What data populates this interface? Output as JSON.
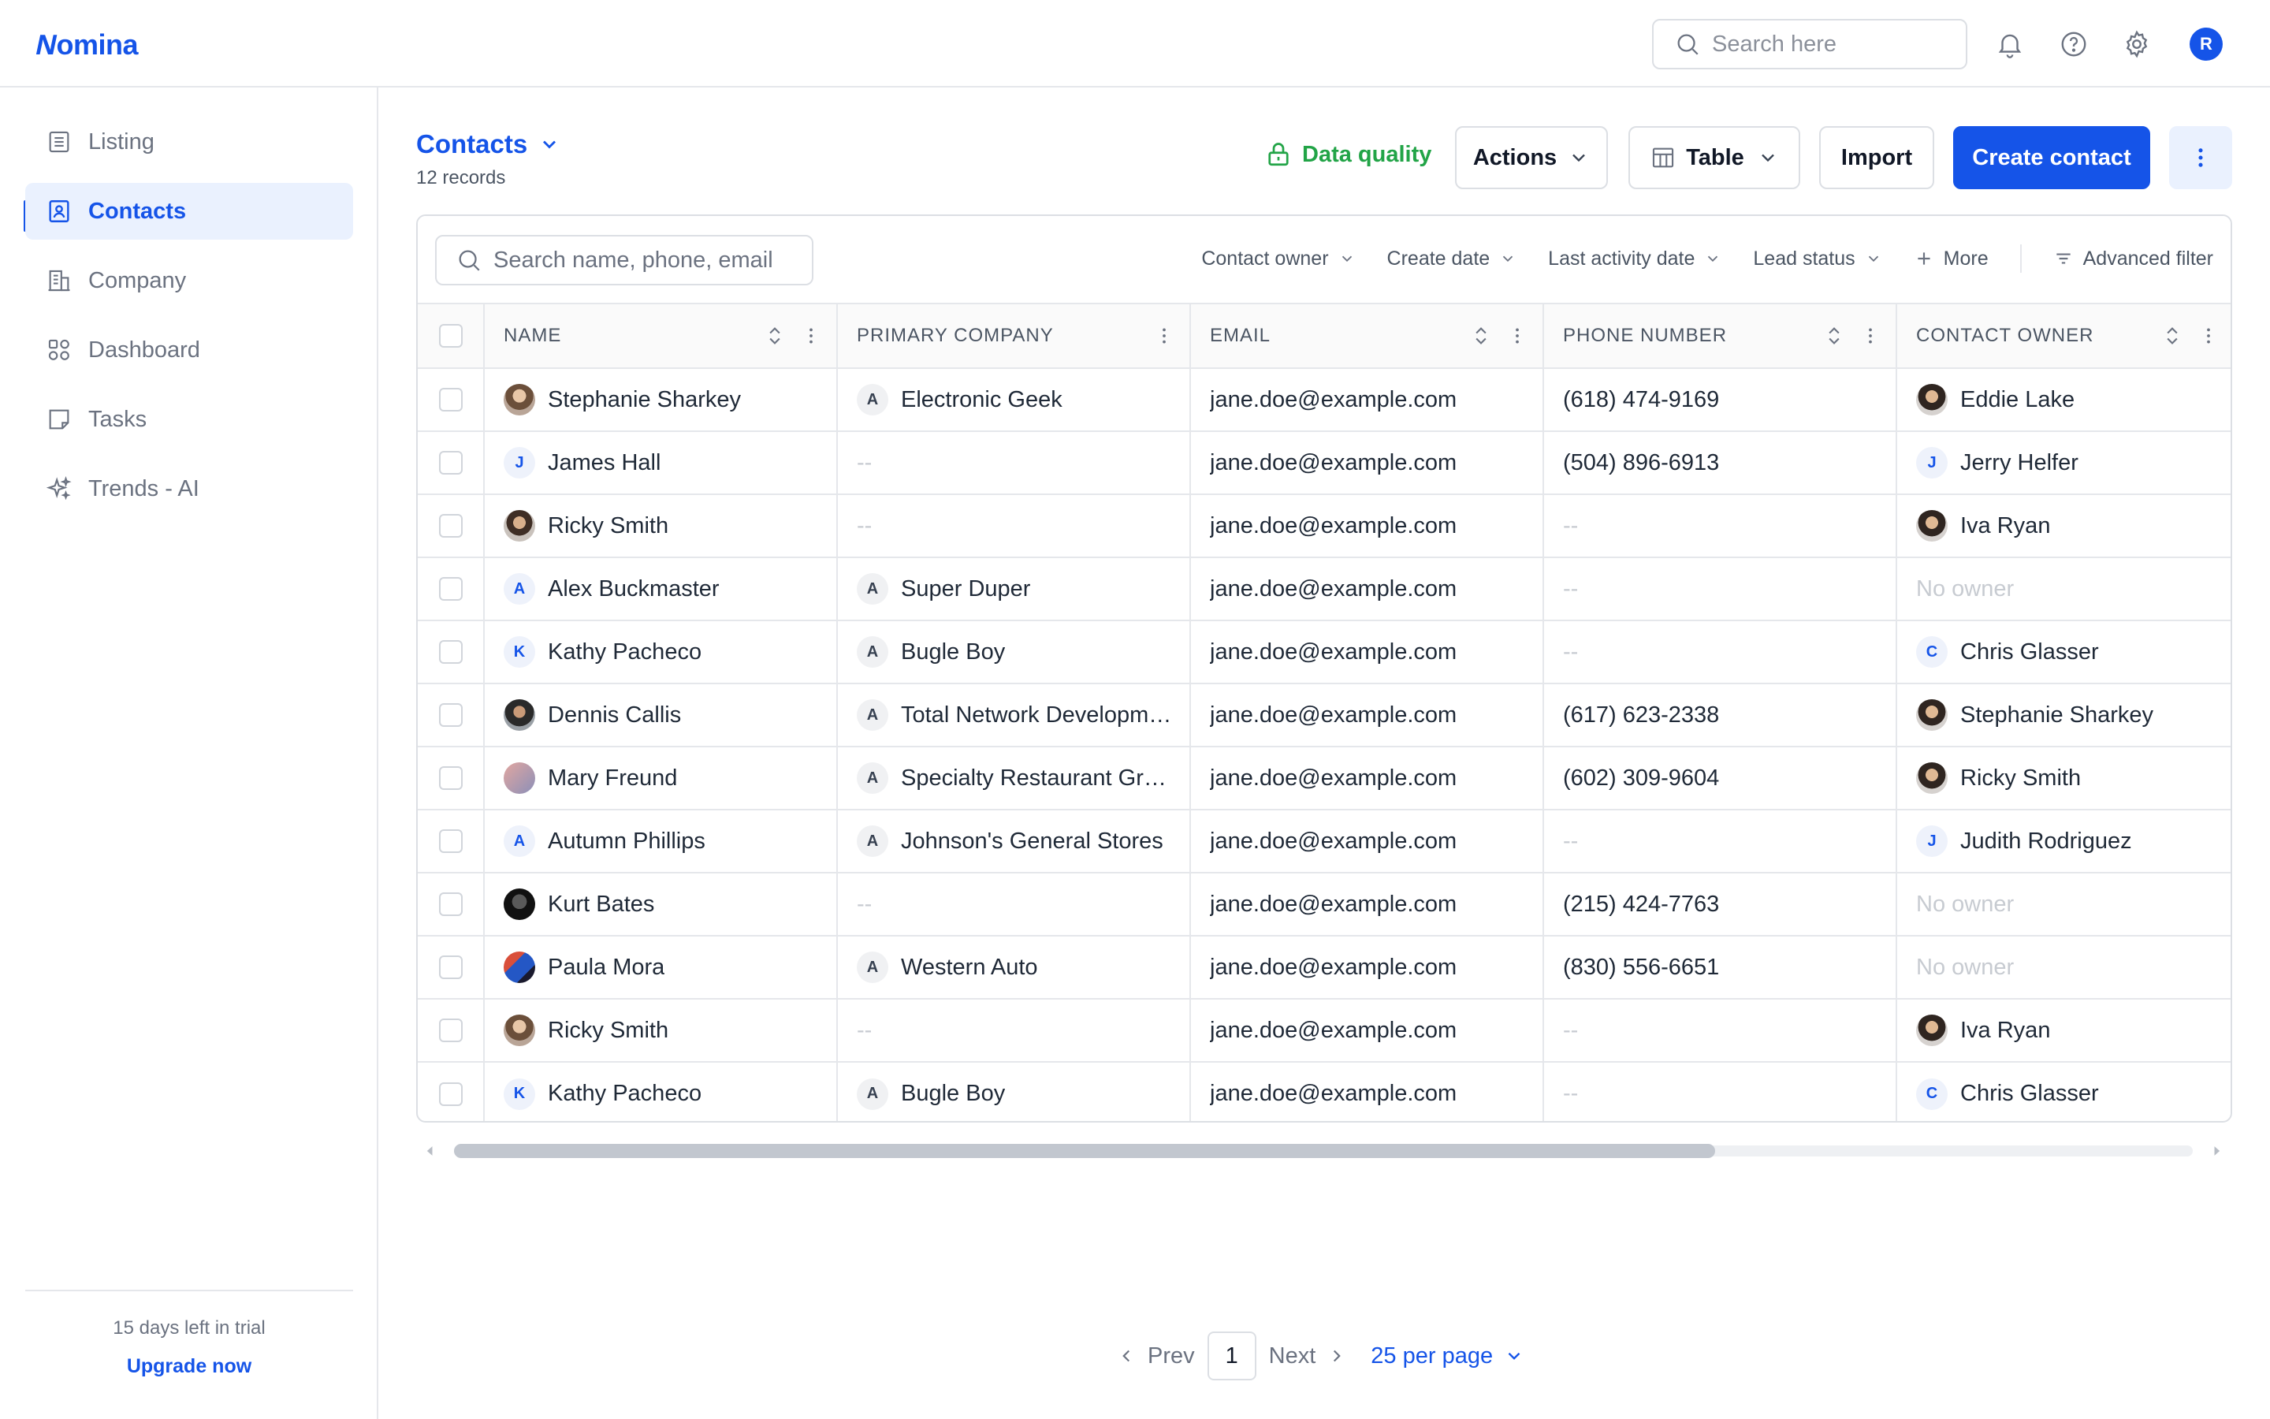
{
  "app": {
    "logo_first": "N",
    "logo_rest": "omina"
  },
  "topbar": {
    "search_placeholder": "Search here",
    "avatar_initial": "R"
  },
  "sidebar": {
    "items": [
      {
        "label": "Listing",
        "icon": "listing-icon"
      },
      {
        "label": "Contacts",
        "icon": "contacts-icon",
        "active": true
      },
      {
        "label": "Company",
        "icon": "building-icon"
      },
      {
        "label": "Dashboard",
        "icon": "dashboard-icon"
      },
      {
        "label": "Tasks",
        "icon": "tasks-icon"
      },
      {
        "label": "Trends - AI",
        "icon": "sparkle-icon"
      }
    ],
    "trial_text": "15 days left in trial",
    "upgrade_label": "Upgrade now"
  },
  "header": {
    "title": "Contacts",
    "records": "12 records",
    "data_quality": "Data quality",
    "actions": "Actions",
    "view": "Table",
    "import": "Import",
    "create": "Create contact"
  },
  "table_toolbar": {
    "search_placeholder": "Search name, phone, email",
    "filters": [
      "Contact owner",
      "Create date",
      "Last activity date",
      "Lead status"
    ],
    "more": "More",
    "advanced": "Advanced filter"
  },
  "columns": [
    "NAME",
    "PRIMARY COMPANY",
    "EMAIL",
    "PHONE NUMBER",
    "CONTACT OWNER"
  ],
  "rows": [
    {
      "name": "Stephanie Sharkey",
      "avatar": "photo",
      "company": "Electronic Geek",
      "email": "jane.doe@example.com",
      "phone": "(618) 474-9169",
      "owner": "Eddie Lake",
      "owner_avatar": "photo"
    },
    {
      "name": "James Hall",
      "avatar": "J",
      "company": "--",
      "email": "jane.doe@example.com",
      "phone": "(504) 896-6913",
      "owner": "Jerry Helfer",
      "owner_avatar": "J"
    },
    {
      "name": "Ricky Smith",
      "avatar": "photo",
      "company": "--",
      "email": "jane.doe@example.com",
      "phone": "--",
      "owner": "Iva Ryan",
      "owner_avatar": "photo"
    },
    {
      "name": "Alex Buckmaster",
      "avatar": "A",
      "company": "Super Duper",
      "email": "jane.doe@example.com",
      "phone": "--",
      "owner": "No owner",
      "owner_avatar": ""
    },
    {
      "name": "Kathy Pacheco",
      "avatar": "K",
      "company": "Bugle Boy",
      "email": "jane.doe@example.com",
      "phone": "--",
      "owner": "Chris Glasser",
      "owner_avatar": "C"
    },
    {
      "name": "Dennis Callis",
      "avatar": "photo",
      "company": "Total Network Development",
      "email": "jane.doe@example.com",
      "phone": "(617) 623-2338",
      "owner": "Stephanie Sharkey",
      "owner_avatar": "photo"
    },
    {
      "name": "Mary Freund",
      "avatar": "photo",
      "company": "Specialty Restaurant Group",
      "email": "jane.doe@example.com",
      "phone": "(602) 309-9604",
      "owner": "Ricky Smith",
      "owner_avatar": "photo"
    },
    {
      "name": "Autumn Phillips",
      "avatar": "A",
      "company": "Johnson's General Stores",
      "email": "jane.doe@example.com",
      "phone": "--",
      "owner": "Judith Rodriguez",
      "owner_avatar": "J"
    },
    {
      "name": "Kurt Bates",
      "avatar": "photo",
      "company": "--",
      "email": "jane.doe@example.com",
      "phone": "(215) 424-7763",
      "owner": "No owner",
      "owner_avatar": ""
    },
    {
      "name": "Paula Mora",
      "avatar": "photo",
      "company": "Western Auto",
      "email": "jane.doe@example.com",
      "phone": "(830) 556-6651",
      "owner": "No owner",
      "owner_avatar": ""
    },
    {
      "name": "Ricky Smith",
      "avatar": "photo",
      "company": "--",
      "email": "jane.doe@example.com",
      "phone": "--",
      "owner": "Iva Ryan",
      "owner_avatar": "photo"
    },
    {
      "name": "Kathy Pacheco",
      "avatar": "K",
      "company": "Bugle Boy",
      "email": "jane.doe@example.com",
      "phone": "--",
      "owner": "Chris Glasser",
      "owner_avatar": "C"
    }
  ],
  "pagination": {
    "prev": "Prev",
    "page": "1",
    "next": "Next",
    "per_page": "25 per page"
  },
  "colors": {
    "brand": "#1554e8",
    "success": "#22a447",
    "active_bg": "#eaf1fe"
  }
}
